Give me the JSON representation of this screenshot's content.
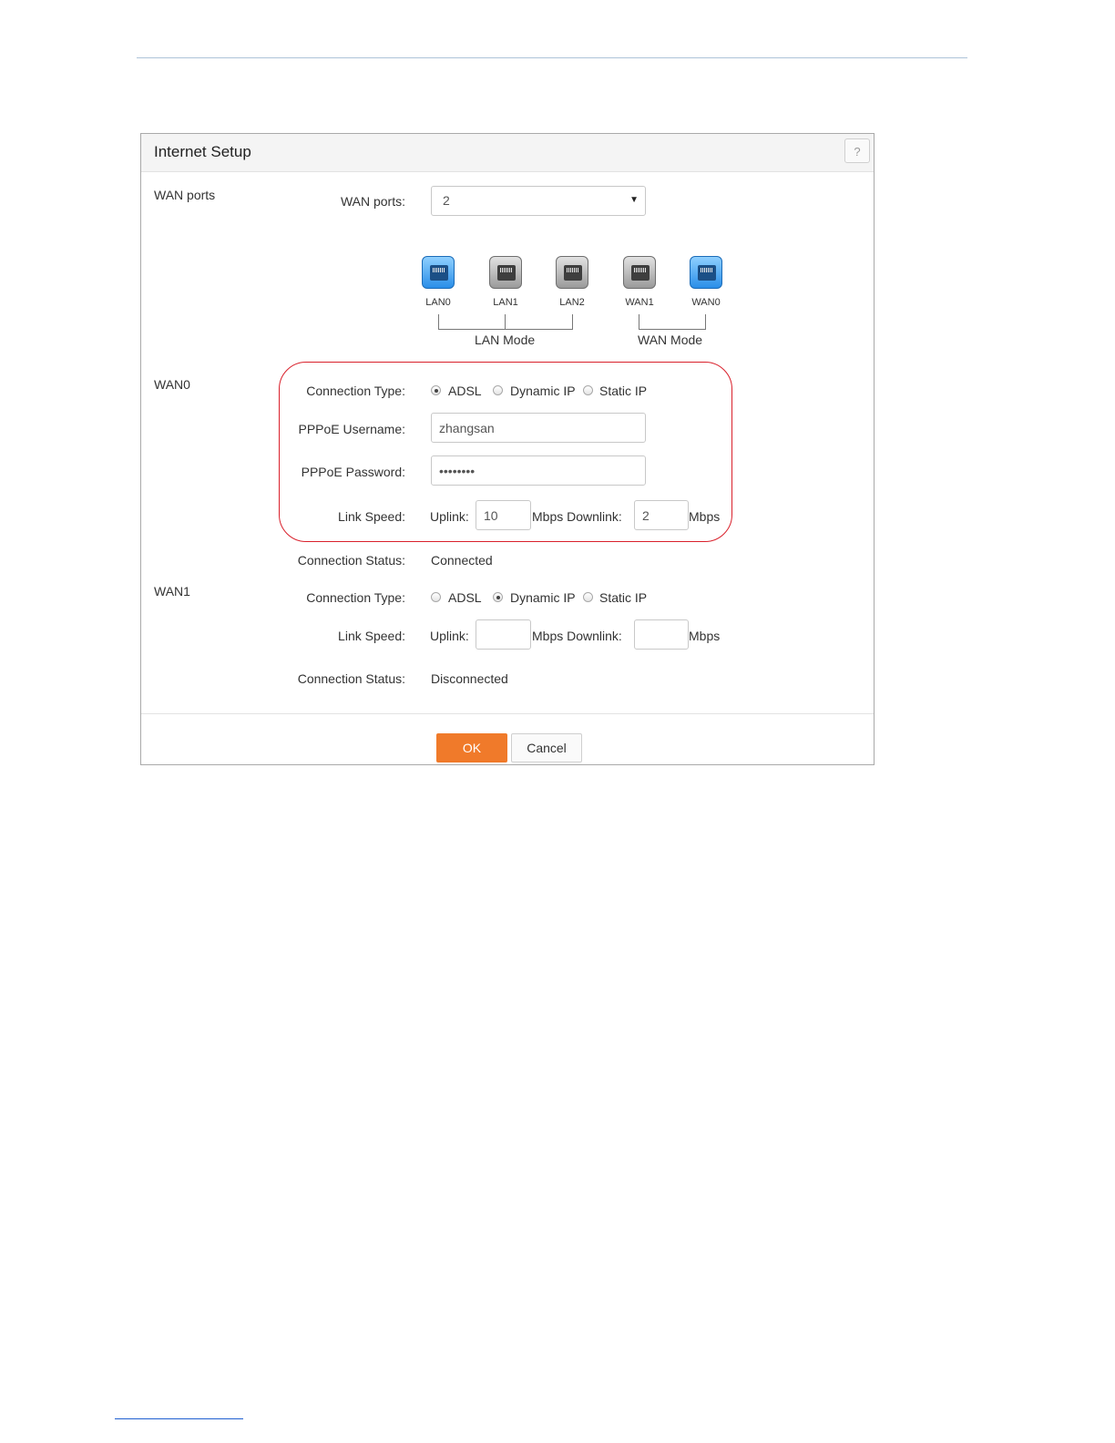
{
  "dialog": {
    "title": "Internet Setup",
    "help_icon": "?",
    "wan_ports_section_label": "WAN ports",
    "wan_ports_field_label": "WAN ports:",
    "wan_ports_value": "2",
    "ports": [
      {
        "label": "LAN0",
        "state": "active",
        "color": "#2a8ee8"
      },
      {
        "label": "LAN1",
        "state": "inactive",
        "color": "#9a9a9a"
      },
      {
        "label": "LAN2",
        "state": "inactive",
        "color": "#9a9a9a"
      },
      {
        "label": "WAN1",
        "state": "inactive",
        "color": "#9a9a9a"
      },
      {
        "label": "WAN0",
        "state": "active",
        "color": "#2a8ee8"
      }
    ],
    "lan_mode_label": "LAN Mode",
    "wan_mode_label": "WAN Mode",
    "wan0": {
      "section_label": "WAN0",
      "connection_type_label": "Connection Type:",
      "options": [
        "ADSL",
        "Dynamic IP",
        "Static IP"
      ],
      "selected": "ADSL",
      "pppoe_username_label": "PPPoE Username:",
      "pppoe_username_value": "zhangsan",
      "pppoe_password_label": "PPPoE Password:",
      "pppoe_password_value": "••••••••",
      "link_speed_label": "Link Speed:",
      "uplink_label": "Uplink:",
      "uplink_value": "10",
      "downlink_label": "Mbps Downlink:",
      "downlink_value": "2",
      "unit_label": "Mbps",
      "connection_status_label": "Connection Status:",
      "connection_status_value": "Connected"
    },
    "wan1": {
      "section_label": "WAN1",
      "connection_type_label": "Connection Type:",
      "options": [
        "ADSL",
        "Dynamic IP",
        "Static IP"
      ],
      "selected": "Dynamic IP",
      "link_speed_label": "Link Speed:",
      "uplink_label": "Uplink:",
      "uplink_value": "",
      "downlink_label": "Mbps Downlink:",
      "downlink_value": "",
      "unit_label": "Mbps",
      "connection_status_label": "Connection Status:",
      "connection_status_value": "Disconnected"
    },
    "ok_label": "OK",
    "cancel_label": "Cancel",
    "colors": {
      "ok_button": "#f07a2a",
      "highlight": "#d9202b"
    }
  }
}
